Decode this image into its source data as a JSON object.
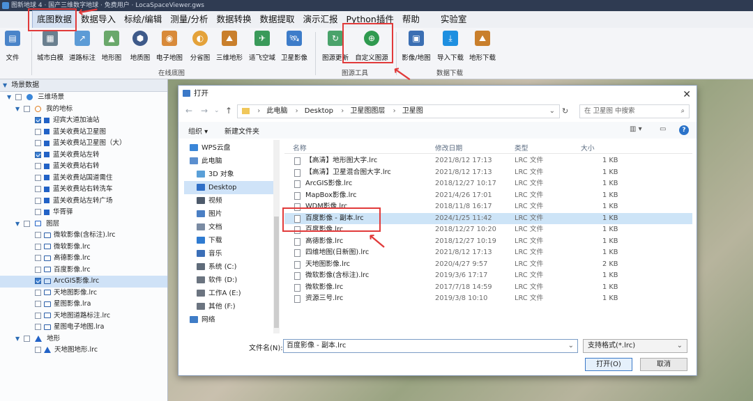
{
  "titlebar": {
    "text": "图新地球 4 · 国产三维数字地球 · 免费用户 · LocaSpaceViewer.gws"
  },
  "menubar": {
    "items": [
      "底图数据",
      "数据导入",
      "标绘/编辑",
      "测量/分析",
      "数据转换",
      "数据提取",
      "演示汇报",
      "Python插件",
      "帮助",
      "实验室"
    ]
  },
  "ribbon": {
    "file": "文件",
    "online_buttons": [
      "城市白模",
      "道路标注",
      "地形图",
      "地质图",
      "电子地图",
      "分省图",
      "三维地形",
      "适飞空域",
      "卫星影像"
    ],
    "online_group": "在线底图",
    "source_buttons": [
      "图源更新",
      "自定义图源"
    ],
    "source_group": "图源工具",
    "download_buttons": [
      "影像/地图",
      "导入下载",
      "地形下载"
    ],
    "download_group": "数据下载"
  },
  "tree": {
    "header": "场景数据",
    "root": "三维场景",
    "places_group": "我的地标",
    "places": [
      {
        "label": "迎宾大道加油站",
        "checked": true
      },
      {
        "label": "蓝关收费站卫星图",
        "checked": false
      },
      {
        "label": "蓝关收费站卫星图（大）",
        "checked": false
      },
      {
        "label": "蓝关收费站左转",
        "checked": true
      },
      {
        "label": "蓝关收费站右转",
        "checked": false
      },
      {
        "label": "蓝关收费站国道需住",
        "checked": false
      },
      {
        "label": "蓝关收费站右转洗车",
        "checked": false
      },
      {
        "label": "蓝关收费站左转广场",
        "checked": false
      },
      {
        "label": "华胥驿",
        "checked": false
      }
    ],
    "layers_group": "图层",
    "layers": [
      {
        "label": "微软影像(含标注).lrc",
        "checked": false
      },
      {
        "label": "微软影像.lrc",
        "checked": false
      },
      {
        "label": "高德影像.lrc",
        "checked": false
      },
      {
        "label": "百度影像.lrc",
        "checked": false
      },
      {
        "label": "ArcGIS影像.lrc",
        "checked": true
      },
      {
        "label": "天地图影像.lrc",
        "checked": false
      },
      {
        "label": "星图影像.lra",
        "checked": false
      },
      {
        "label": "天地图道路标注.lrc",
        "checked": false
      },
      {
        "label": "星图电子地图.lra",
        "checked": false
      }
    ],
    "terrain_group": "地形",
    "terrain": [
      {
        "label": "天地图地形.lrc",
        "checked": false
      }
    ]
  },
  "dialog": {
    "title": "打开",
    "breadcrumb": [
      "此电脑",
      "Desktop",
      "卫星图图层",
      "卫星图"
    ],
    "search_placeholder": "在 卫星图 中搜索",
    "organize": "组织 ▾",
    "new_folder": "新建文件夹",
    "nav": [
      {
        "label": "WPS云盘",
        "color": "#3a86d8"
      },
      {
        "label": "此电脑",
        "color": "#5b8fcf"
      },
      {
        "label": "3D 对象",
        "color": "#5aa0d8"
      },
      {
        "label": "Desktop",
        "color": "#2f6fc7"
      },
      {
        "label": "视频",
        "color": "#4d5a6b"
      },
      {
        "label": "图片",
        "color": "#4a7fc4"
      },
      {
        "label": "文档",
        "color": "#7a8ba3"
      },
      {
        "label": "下载",
        "color": "#2f7bd1"
      },
      {
        "label": "音乐",
        "color": "#3b6fb8"
      },
      {
        "label": "系统 (C:)",
        "color": "#5f6b7a"
      },
      {
        "label": "软件 (D:)",
        "color": "#6b7480"
      },
      {
        "label": "工作A (E:)",
        "color": "#6b7480"
      },
      {
        "label": "其他 (F:)",
        "color": "#6b7480"
      },
      {
        "label": "网络",
        "color": "#3f7dc7"
      }
    ],
    "columns": [
      "名称",
      "修改日期",
      "类型",
      "大小"
    ],
    "files": [
      {
        "name": "【高清】地形图大字.lrc",
        "date": "2021/8/12 17:13",
        "type": "LRC 文件",
        "size": "1 KB"
      },
      {
        "name": "【高清】卫星混合图大字.lrc",
        "date": "2021/8/12 17:13",
        "type": "LRC 文件",
        "size": "1 KB"
      },
      {
        "name": "ArcGIS影像.lrc",
        "date": "2018/12/27 10:17",
        "type": "LRC 文件",
        "size": "1 KB"
      },
      {
        "name": "MapBox影像.lrc",
        "date": "2021/4/26 17:01",
        "type": "LRC 文件",
        "size": "1 KB"
      },
      {
        "name": "WDM影像.lrc",
        "date": "2018/11/8 16:17",
        "type": "LRC 文件",
        "size": "1 KB"
      },
      {
        "name": "百度影像 - 副本.lrc",
        "date": "2024/1/25 11:42",
        "type": "LRC 文件",
        "size": "1 KB"
      },
      {
        "name": "百度影像.lrc",
        "date": "2018/12/27 10:20",
        "type": "LRC 文件",
        "size": "1 KB"
      },
      {
        "name": "高德影像.lrc",
        "date": "2018/12/27 10:19",
        "type": "LRC 文件",
        "size": "1 KB"
      },
      {
        "name": "四维地图(日新图).lrc",
        "date": "2021/8/12 17:13",
        "type": "LRC 文件",
        "size": "1 KB"
      },
      {
        "name": "天地图影像.lrc",
        "date": "2020/4/27 9:57",
        "type": "LRC 文件",
        "size": "2 KB"
      },
      {
        "name": "微软影像(含标注).lrc",
        "date": "2019/3/6 17:17",
        "type": "LRC 文件",
        "size": "1 KB"
      },
      {
        "name": "微软影像.lrc",
        "date": "2017/7/18 14:59",
        "type": "LRC 文件",
        "size": "1 KB"
      },
      {
        "name": "资源三号.lrc",
        "date": "2019/3/8 10:10",
        "type": "LRC 文件",
        "size": "1 KB"
      }
    ],
    "selected_index": 5,
    "filename_label": "文件名(N):",
    "filename_value": "百度影像 - 副本.lrc",
    "filetype_value": "支持格式(*.lrc)",
    "open_label": "打开(O)",
    "cancel_label": "取消"
  },
  "colors": {
    "accent": "#3b79c8",
    "annotation": "#e13a3a",
    "selected": "#cde4f7"
  }
}
